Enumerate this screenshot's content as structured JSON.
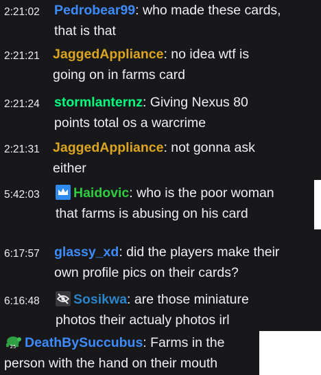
{
  "colors": {
    "panel": "#18181b",
    "text": "#efeff1",
    "username_blue": "#3d8bfd",
    "username_gold": "#daa520",
    "username_green": "#00ff7f",
    "username_mod_green": "#2ecc40",
    "username_teal": "#1e90ff",
    "badge_blue": "#2e8cf0",
    "badge_green": "#2ea043"
  },
  "messages": [
    {
      "timestamp": "2:21:02",
      "username": "Pedrobear99",
      "username_color": "#3d8bfd",
      "separator": ":",
      "lines": [
        " who made these cards,",
        "that is that"
      ]
    },
    {
      "timestamp": "2:21:21",
      "username": "JaggedAppliance",
      "username_color": "#daa520",
      "separator": ":",
      "lines": [
        " no idea wtf is",
        "going on in farms card"
      ]
    },
    {
      "timestamp": "2:21:24",
      "username": "stormlanternz",
      "username_color": "#00ff7f",
      "separator": ":",
      "lines": [
        " Giving Nexus 80",
        "points total os a warcrime"
      ]
    },
    {
      "timestamp": "2:21:31",
      "username": "JaggedAppliance",
      "username_color": "#daa520",
      "separator": ":",
      "lines": [
        " not gonna ask",
        "either"
      ]
    },
    {
      "timestamp": "5:42:03",
      "badge": "crown-badge-icon",
      "username": "Haidovic",
      "username_color": "#2ecc40",
      "separator": ":",
      "lines": [
        " who is the poor woman",
        "that farms is abusing on his card"
      ]
    },
    {
      "timestamp": "6:17:57",
      "username": "glassy_xd",
      "username_color": "#3d8bfd",
      "separator": ":",
      "lines": [
        " did the players make their",
        "own profile pics on their cards?"
      ]
    },
    {
      "timestamp": "6:16:48",
      "badge": "no-audio-badge-icon",
      "username": "Sosikwa",
      "username_color": "#2b84c7",
      "separator": ":",
      "lines": [
        " are those miniature",
        "photos their actualy photos irl"
      ]
    },
    {
      "timestamp": "",
      "badge": "turtle-badge-icon",
      "username": "DeathBySuccubus",
      "username_color": "#3d8bfd",
      "separator": ":",
      "lines": [
        " Farms in the",
        "person with the hand on their mouth"
      ]
    }
  ]
}
